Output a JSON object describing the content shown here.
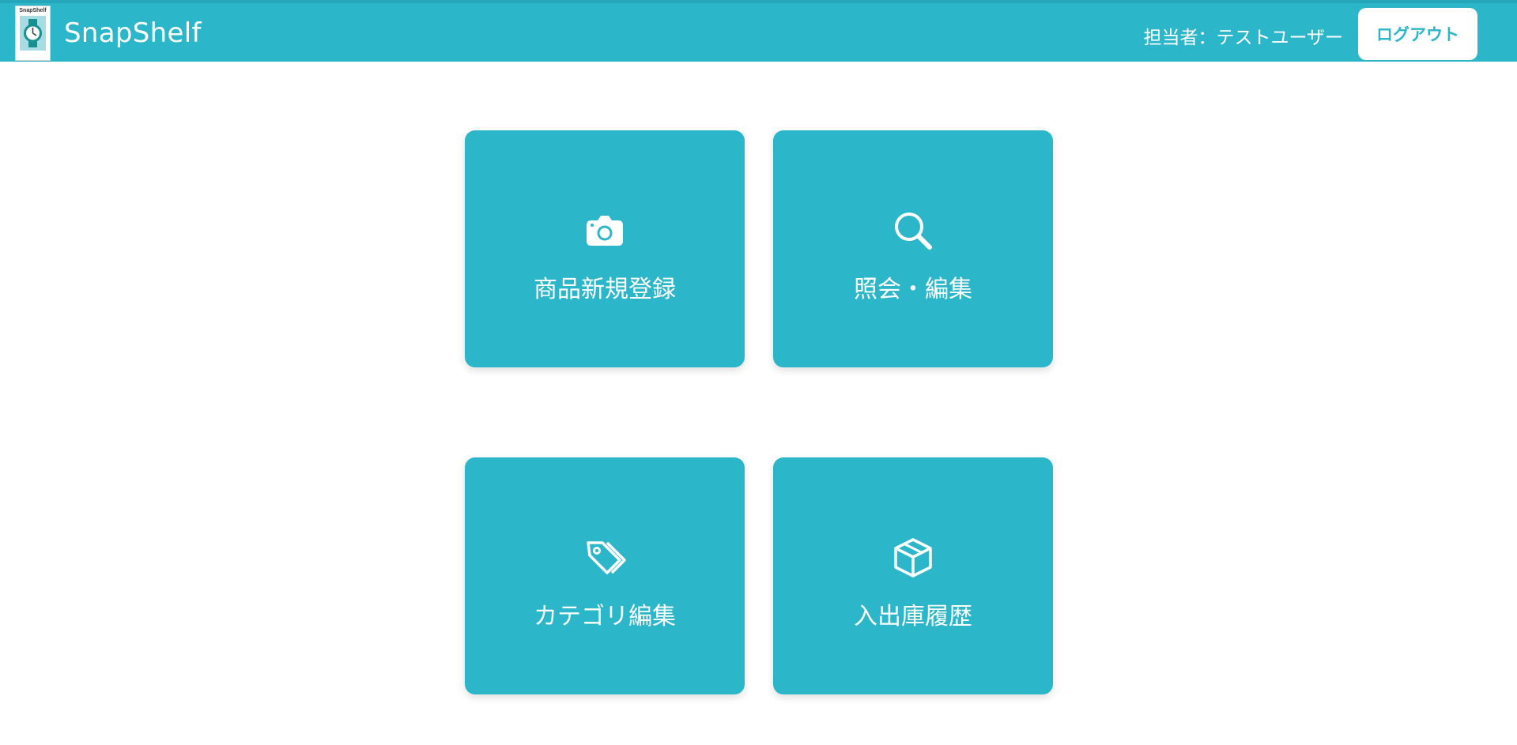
{
  "header": {
    "logo_text": "SnapShelf",
    "app_title": "SnapShelf",
    "user_label": "担当者：テストユーザー",
    "logout_label": "ログアウト"
  },
  "menu": [
    {
      "label": "商品新規登録",
      "icon": "camera-icon"
    },
    {
      "label": "照会・編集",
      "icon": "search-icon"
    },
    {
      "label": "カテゴリ編集",
      "icon": "tags-icon"
    },
    {
      "label": "入出庫履歴",
      "icon": "box-icon"
    }
  ],
  "colors": {
    "accent": "#2cb6ca",
    "card_text": "#ffffff",
    "background": "#ffffff"
  }
}
